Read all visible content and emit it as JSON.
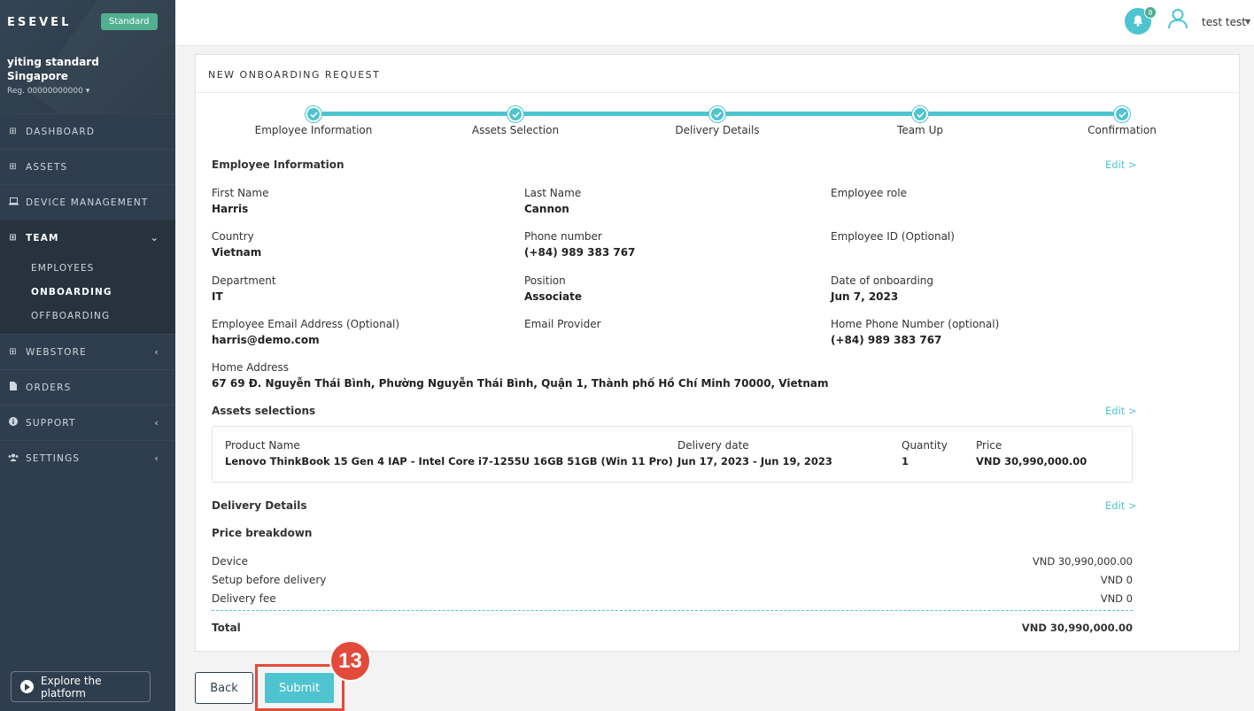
{
  "sidebar": {
    "logo": "ESEVEL",
    "plan": "Standard",
    "company_name": "yiting standard",
    "company_location": "Singapore",
    "reg": "Reg. 00000000000",
    "items": [
      {
        "label": "DASHBOARD",
        "icon": "grid-icon"
      },
      {
        "label": "ASSETS",
        "icon": "grid-icon"
      },
      {
        "label": "DEVICE MANAGEMENT",
        "icon": "laptop-icon"
      },
      {
        "label": "TEAM",
        "icon": "grid-icon"
      },
      {
        "label": "WEBSTORE",
        "icon": "grid-icon"
      },
      {
        "label": "ORDERS",
        "icon": "document-icon"
      },
      {
        "label": "SUPPORT",
        "icon": "info-icon"
      },
      {
        "label": "SETTINGS",
        "icon": "users-icon"
      }
    ],
    "team_sub": [
      "EMPLOYEES",
      "ONBOARDING",
      "OFFBOARDING"
    ],
    "explore": "Explore the platform"
  },
  "header": {
    "notification_count": "8",
    "user_name": "test test"
  },
  "card": {
    "title": "NEW ONBOARDING REQUEST",
    "steps": [
      "Employee Information",
      "Assets Selection",
      "Delivery Details",
      "Team Up",
      "Confirmation"
    ]
  },
  "employee": {
    "section_title": "Employee Information",
    "edit": "Edit >",
    "first_name_label": "First Name",
    "first_name": "Harris",
    "last_name_label": "Last Name",
    "last_name": "Cannon",
    "role_label": "Employee role",
    "role": "",
    "country_label": "Country",
    "country": "Vietnam",
    "phone_label": "Phone number",
    "phone": "(+84) 989 383 767",
    "employee_id_label": "Employee ID (Optional)",
    "employee_id": "",
    "department_label": "Department",
    "department": "IT",
    "position_label": "Position",
    "position": "Associate",
    "onboarding_date_label": "Date of onboarding",
    "onboarding_date": "Jun 7, 2023",
    "email_label": "Employee Email Address (Optional)",
    "email": "harris@demo.com",
    "email_provider_label": "Email Provider",
    "email_provider": "",
    "home_phone_label": "Home Phone Number (optional)",
    "home_phone": "(+84) 989 383 767",
    "address_label": "Home Address",
    "address": "67 69 Đ. Nguyễn Thái Bình, Phường Nguyễn Thái Bình, Quận 1, Thành phố Hồ Chí Minh 70000, Vietnam"
  },
  "assets": {
    "section_title": "Assets selections",
    "edit": "Edit >",
    "product_label": "Product Name",
    "product": "Lenovo ThinkBook 15 Gen 4 IAP - Intel Core i7-1255U 16GB 51GB (Win 11 Pro)",
    "delivery_label": "Delivery date",
    "delivery": "Jun 17, 2023 - Jun 19, 2023",
    "quantity_label": "Quantity",
    "quantity": "1",
    "price_label": "Price",
    "price": "VND 30,990,000.00"
  },
  "delivery": {
    "section_title": "Delivery Details",
    "edit": "Edit >"
  },
  "price_breakdown": {
    "title": "Price breakdown",
    "device_label": "Device",
    "device": "VND 30,990,000.00",
    "setup_label": "Setup before delivery",
    "setup": "VND 0",
    "fee_label": "Delivery fee",
    "fee": "VND 0",
    "total_label": "Total",
    "total": "VND 30,990,000.00"
  },
  "actions": {
    "back": "Back",
    "submit": "Submit",
    "step_marker": "13"
  },
  "colors": {
    "accent": "#4ec4d0",
    "sidebar": "#2f3e4e",
    "marker": "#e34a3a"
  }
}
